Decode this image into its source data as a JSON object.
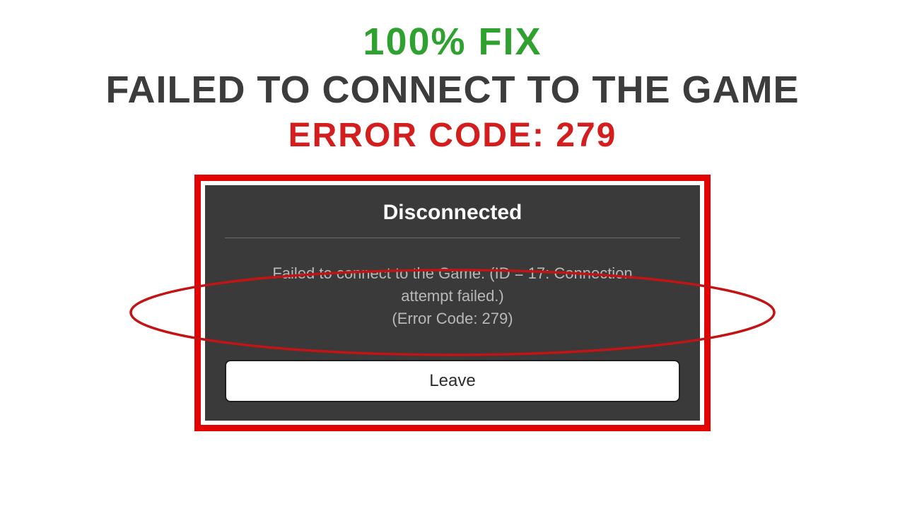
{
  "heading": {
    "fix": "100% FIX",
    "failed": "FAILED TO CONNECT TO THE GAME",
    "error": "ERROR CODE: 279"
  },
  "dialog": {
    "title": "Disconnected",
    "body_line1": "Failed to connect to the Game. (ID = 17: Connection",
    "body_line2": "attempt failed.)",
    "body_line3": "(Error Code: 279)",
    "leave_label": "Leave"
  },
  "colors": {
    "green": "#2fa12f",
    "grey_text": "#3c3c3c",
    "red": "#d41e1e",
    "accent_red": "#e20303",
    "dialog_bg": "#3a3a3a"
  }
}
